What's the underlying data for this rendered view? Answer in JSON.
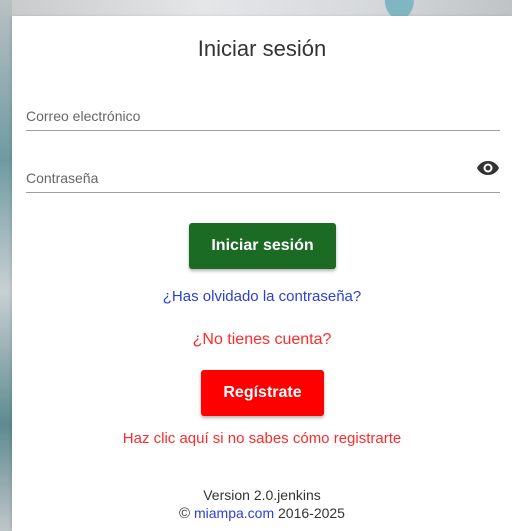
{
  "login": {
    "title": "Iniciar sesión",
    "email_placeholder": "Correo electrónico",
    "password_placeholder": "Contraseña",
    "submit_label": "Iniciar sesión",
    "forgot_password": "¿Has olvidado la contraseña?"
  },
  "register": {
    "prompt": "¿No tienes cuenta?",
    "button_label": "Regístrate",
    "help_link": "Haz clic aquí si no sabes cómo registrarte"
  },
  "footer": {
    "version": "Version 2.0.jenkins",
    "copyright_symbol": "©",
    "site_link": "miampa.com",
    "years": " 2016-2025"
  },
  "colors": {
    "login_button": "#1b6b24",
    "register_button": "#ff0000",
    "link_blue": "#2b3fd8",
    "link_red": "#ff2a2a"
  },
  "icons": {
    "password_toggle": "eye-icon"
  }
}
